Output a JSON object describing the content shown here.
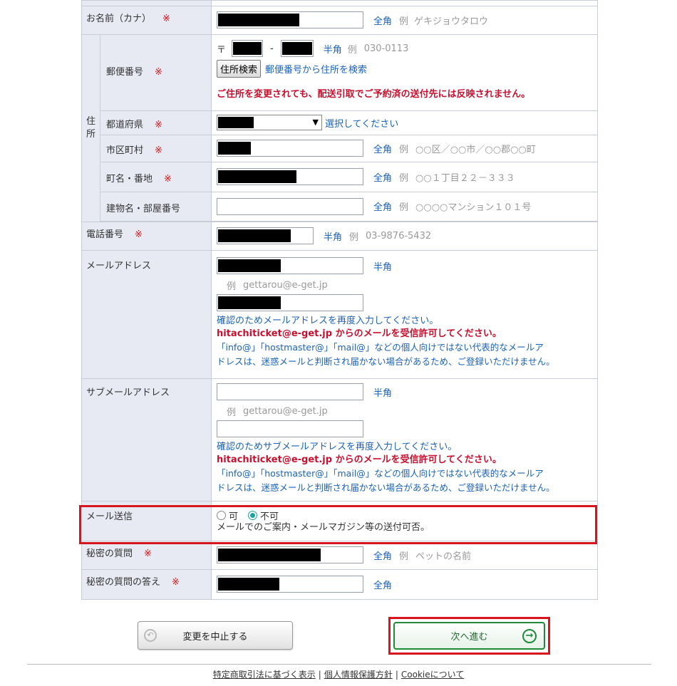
{
  "req_mark": "※",
  "kana": {
    "label": "お名前（カナ）",
    "hint": "全角",
    "ex_prefix": "例",
    "example": "ゲキジョウタロウ"
  },
  "address_group_label": "住所",
  "postal": {
    "label": "郵便番号",
    "mark": "〒",
    "dash": "-",
    "hint": "半角",
    "ex_prefix": "例",
    "example": "030-0113",
    "search_button": "住所検索",
    "search_link": "郵便番号から住所を検索",
    "warning": "ご住所を変更されても、配送引取でご予約済の送付先には反映されません。"
  },
  "prefecture": {
    "label": "都道府県",
    "select_hint": "選択してください"
  },
  "city": {
    "label": "市区町村",
    "hint": "全角",
    "ex_prefix": "例",
    "example": "○○区／○○市／○○郡○○町"
  },
  "street": {
    "label": "町名・番地",
    "hint": "全角",
    "ex_prefix": "例",
    "example": "○○１丁目２２－３３３"
  },
  "building": {
    "label": "建物名・部屋番号",
    "hint": "全角",
    "ex_prefix": "例",
    "example": "○○○○マンション１０１号"
  },
  "phone": {
    "label": "電話番号",
    "hint": "半角",
    "ex_prefix": "例",
    "example": "03-9876-5432"
  },
  "email": {
    "label": "メールアドレス",
    "hint": "半角",
    "ex_prefix": "例",
    "example": "gettarou@e-get.jp",
    "confirm_note": "確認のためメールアドレスを再度入力してください。",
    "permit_note": "hitachiticket@e-get.jp からのメールを受信許可してください。",
    "warn_line1": "「info@」「hostmaster@」「mail@」などの個人向けではない代表的なメールア",
    "warn_line2": "ドレスは、迷惑メールと判断され届かない場合があるため、ご登録いただけません。"
  },
  "sub_email": {
    "label": "サブメールアドレス",
    "hint": "半角",
    "ex_prefix": "例",
    "example": "gettarou@e-get.jp",
    "confirm_note": "確認のためサブメールアドレスを再度入力してください。",
    "permit_note": "hitachiticket@e-get.jp からのメールを受信許可してください。",
    "warn_line1": "「info@」「hostmaster@」「mail@」などの個人向けではない代表的なメールア",
    "warn_line2": "ドレスは、迷惑メールと判断され届かない場合があるため、ご登録いただけません。"
  },
  "mail_send": {
    "label": "メール送信",
    "option_yes": "可",
    "option_no": "不可",
    "selected": "不可",
    "note": "メールでのご案内・メールマガジン等の送付可否。"
  },
  "secret_q": {
    "label": "秘密の質問",
    "hint": "全角",
    "ex_prefix": "例",
    "example": "ペットの名前"
  },
  "secret_a": {
    "label": "秘密の質問の答え",
    "hint": "全角"
  },
  "buttons": {
    "cancel": "変更を中止する",
    "next": "次へ進む"
  },
  "footer": {
    "link1": "特定商取引法に基づく表示",
    "link2": "個人情報保護方針",
    "link3": "Cookieについて",
    "sep": "|"
  },
  "colors": {
    "highlight": "#d8141c",
    "label_bg": "#e8eaf3",
    "link_blue": "#1a62b8",
    "warn_red": "#c8102e",
    "next_green": "#1f8b38"
  }
}
